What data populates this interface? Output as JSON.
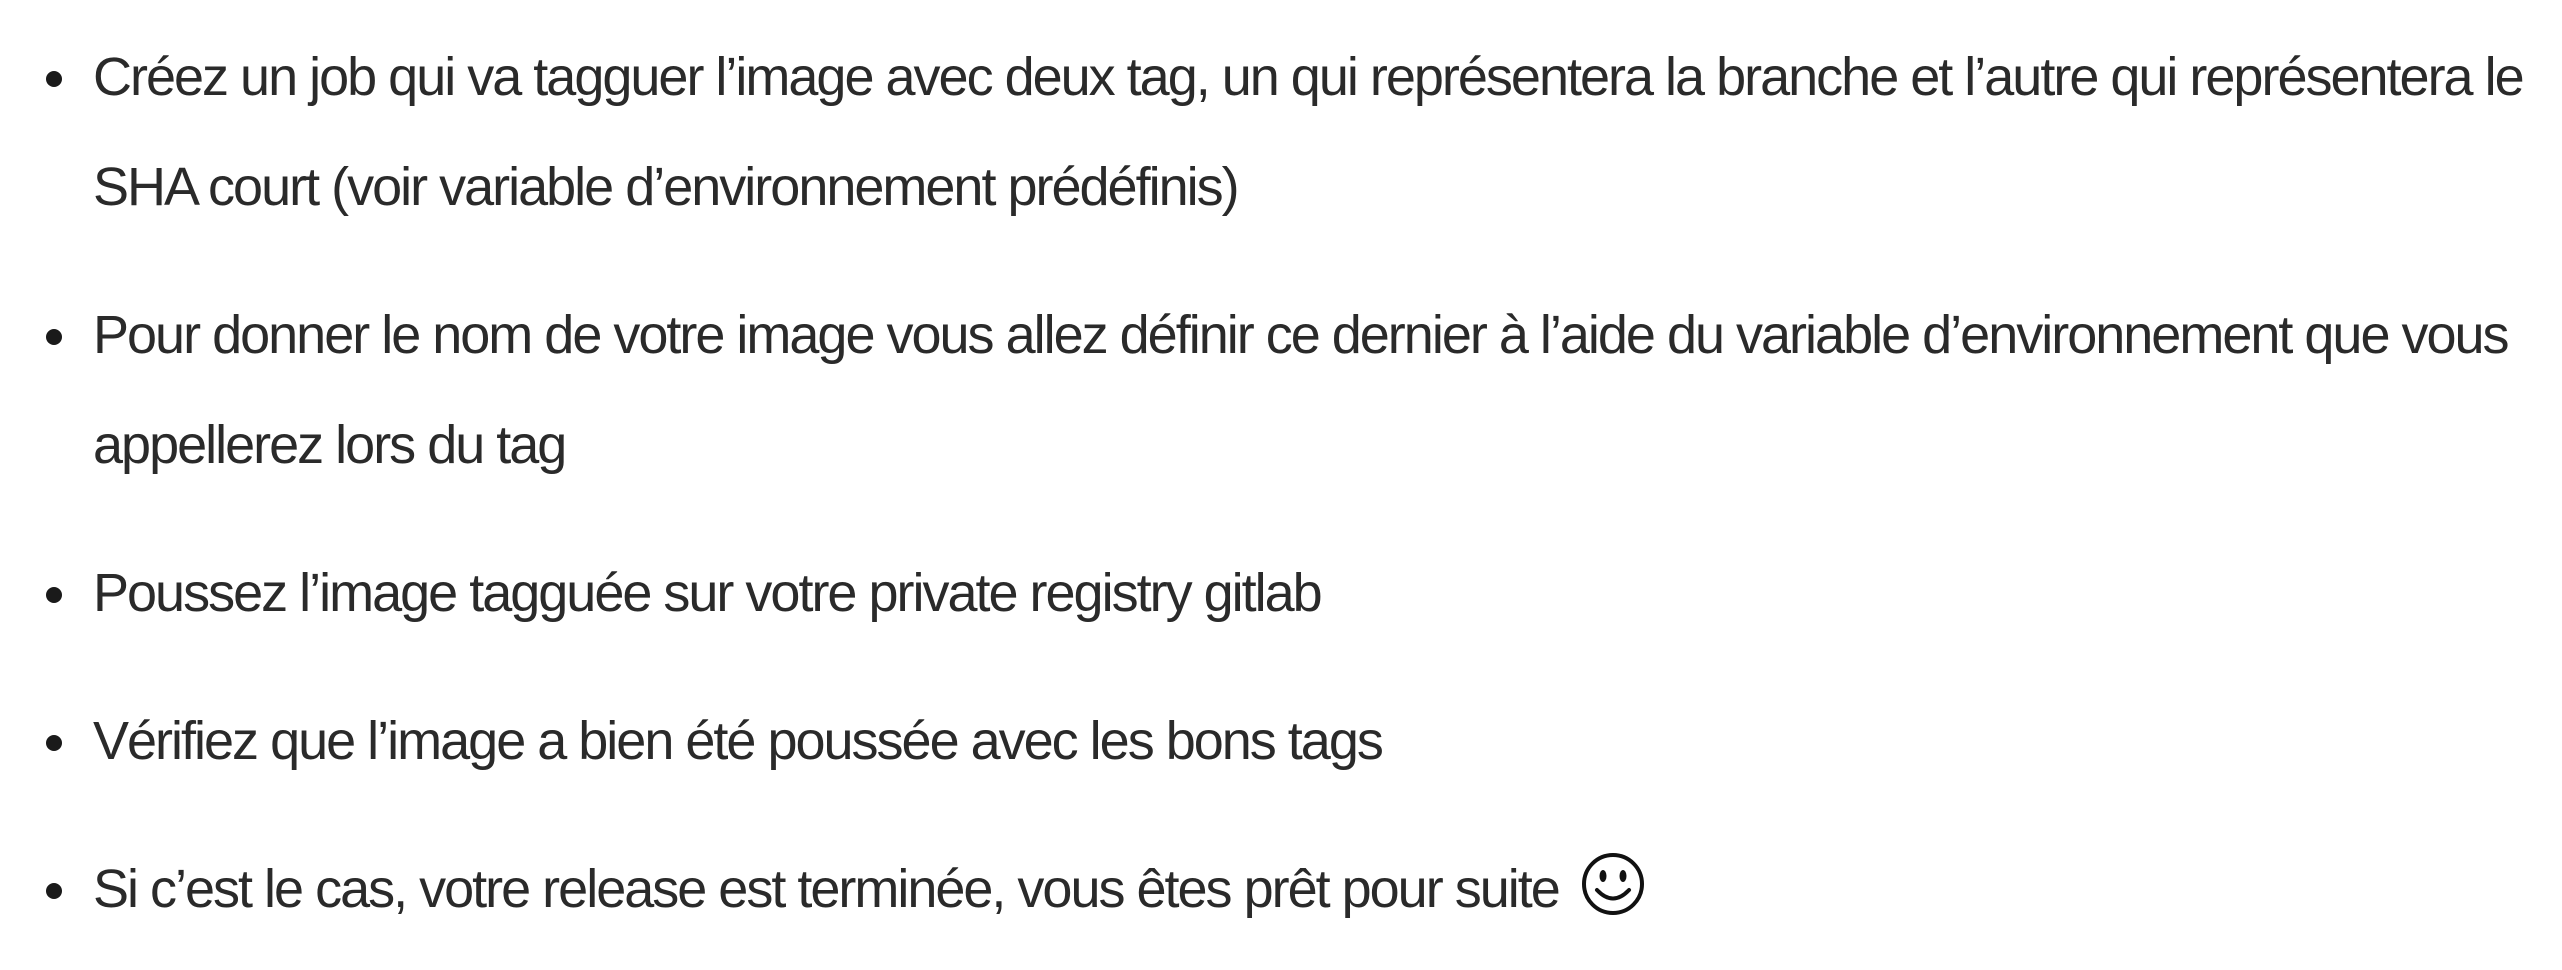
{
  "bullets": [
    {
      "text": "Créez un job qui va tagguer l’image avec deux tag, un qui représentera la branche et l’autre qui représentera le SHA court (voir variable d’environnement prédéfinis)"
    },
    {
      "text": "Pour donner le nom de votre image vous allez définir ce dernier à l’aide du variable d’environnement que vous appellerez lors du tag"
    },
    {
      "text": "Poussez l’image tagguée sur votre private registry gitlab"
    },
    {
      "text": "Vérifiez que l’image a bien été poussée avec les bons tags"
    },
    {
      "text": "Si c’est le cas, votre release est terminée, vous êtes prêt pour suite",
      "trailing_icon": "smiley-face-icon"
    }
  ]
}
